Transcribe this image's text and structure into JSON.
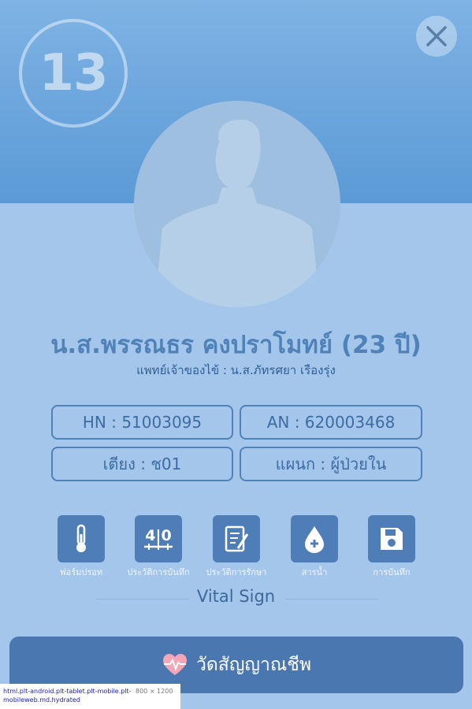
{
  "header": {
    "bed_number": "13",
    "close_icon": "close-icon"
  },
  "patient": {
    "name": "น.ส.พรรณธร คงปราโมทย์ (23 ปี)",
    "doctor_line": "แพทย์เจ้าของไข้ : น.ส.ภัทรศยา เรืองรุ่ง"
  },
  "info": {
    "hn": "HN : 51003095",
    "an": "AN : 620003468",
    "bed": "เตียง : ช01",
    "ward": "แผนก : ผู้ป่วยใน"
  },
  "tools": [
    {
      "label": "ฟอร์มปรอท",
      "icon": "thermometer-icon"
    },
    {
      "label": "ประวัติการบันทึก",
      "icon": "record-history-icon"
    },
    {
      "label": "ประวัติการรักษา",
      "icon": "clipboard-icon"
    },
    {
      "label": "สารน้ำ",
      "icon": "water-drop-icon"
    },
    {
      "label": "การบันทึก",
      "icon": "save-icon"
    }
  ],
  "section": {
    "title": "Vital Sign"
  },
  "vital_button": {
    "label": "วัดสัญญาณชีพ",
    "icon": "heart-pulse-icon"
  },
  "debug": {
    "classes": "html.plt-android.plt-tablet.plt-mobile.plt-mobileweb.md.hydrated",
    "size": "800 × 1200"
  },
  "colors": {
    "header_top": "#7fb3e4",
    "header_bottom": "#5b9ad6",
    "body_bg": "#a4c6ea",
    "accent": "#4f82b9",
    "button": "#4a77b0"
  }
}
